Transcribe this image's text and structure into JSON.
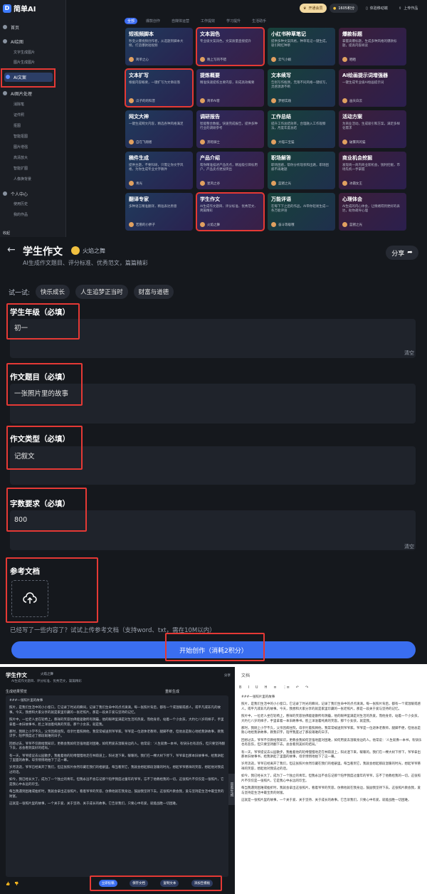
{
  "app": {
    "name": "简单AI"
  },
  "sidebar": {
    "home": "首页",
    "section_ai_image": "AI绘图",
    "ai_image_items": [
      "文字生成图片",
      "图片生成图片"
    ],
    "ai_writing": "AI文案",
    "section_ai_image_process": "AI图片处理",
    "process_items": [
      "消除笔",
      "证件照",
      "抠图",
      "智能抠图",
      "图片增强",
      "高清放大",
      "智能扩图",
      "人像换背景"
    ],
    "section_personal": "个人中心",
    "personal_items": [
      "使用历史",
      "我的作品"
    ],
    "collapse": "收起"
  },
  "topbar": {
    "member": "开通会员",
    "points": "1605积分",
    "mobile": "体验移动端",
    "upload": "上传作品"
  },
  "category_tabs": [
    {
      "label": "全部",
      "active": true
    },
    {
      "label": "爆款创作"
    },
    {
      "label": "自媒体运营"
    },
    {
      "label": "工作提效"
    },
    {
      "label": "学习提升"
    },
    {
      "label": "生活助手"
    }
  ],
  "cards": [
    {
      "title": "短视频脚本",
      "desc": "秒变火爆视频创作者，从选题到脚本大纲，打造爆款短视频",
      "author": "简单之心"
    },
    {
      "title": "文本润色",
      "desc": "专业级文案润色，文案质量直接提升",
      "author": "晚上写的不错",
      "highlight": true
    },
    {
      "title": "小红书种草笔记",
      "desc": "提供多种文案风格，种草笔记一键生成，吸引网红种草",
      "author": "云气小娟"
    },
    {
      "title": "爆款标题",
      "desc": "掌握高爆标题，生成多种风格的爆款标题，提高内容阅读",
      "author": "晒晒"
    },
    {
      "title": "文本扩写",
      "desc": "根据内容概要，一键扩写为文章段落",
      "author": "瓜子的的科普",
      "highlight": true
    },
    {
      "title": "提炼概要",
      "desc": "精准快速提炼主要内容，形成高效概要",
      "author": "简单AI客"
    },
    {
      "title": "文本续写",
      "desc": "告别写作瓶颈，无限不同风格一键续写，灵感源源不断",
      "author": "梦想实践"
    },
    {
      "title": "AI绘画提示词增强器",
      "desc": "一键生成专业级AI绘画提示词",
      "author": "画天白云"
    },
    {
      "title": "网文大神",
      "desc": "一键生成网文内容，精选各种风格满足",
      "author": "自在飞翔者"
    },
    {
      "title": "调研报告",
      "desc": "智能整合数据，快速完成报告，提供多种行业的调研参考",
      "author": "黑暗骑士"
    },
    {
      "title": "工作总结",
      "desc": "提升工作总结效率，合理融入工作观察法，月度年度总结",
      "author": "大喵三宝猫"
    },
    {
      "title": "活动方案",
      "desc": "为商业活动，生成吸引和方案，满足多样化需求",
      "author": "破雾风的猫"
    },
    {
      "title": "稿件生成",
      "desc": "提供主题，不要科研，只需让你文字风格，为你生成专业文字稿件",
      "author": "青光"
    },
    {
      "title": "产品介绍",
      "desc": "帮你精准描述产品优点，精准吸引目标用户，产品卖点更加突出",
      "author": "星风之谷"
    },
    {
      "title": "职场解答",
      "desc": "职场困惑，帮你分析现状和出路，职场困惑不再难题",
      "author": "蓝猪之光"
    },
    {
      "title": "商业机会挖掘",
      "desc": "发现商一商内商业新机会，锐利挖掘，市场先机一手掌握",
      "author": "冰霜女王"
    },
    {
      "title": "翻译专家",
      "desc": "多种语言精准翻译，精准表达原意",
      "author": "若愿的小胖子"
    },
    {
      "title": "学生作文",
      "desc": "AI生成作文题目、评分标准、优秀范文、简篇精彩",
      "author": "火焰之舞",
      "highlight": true
    },
    {
      "title": "万能评语",
      "desc": "在每下下之后的作品，AI带你轻易生成一条万能评语",
      "author": "奋斗等级哦"
    },
    {
      "title": "心理体会",
      "desc": "AI生成的内心体会，让情绪得到更好的表达，助你疏导心理",
      "author": "蓝猪之光"
    }
  ],
  "form": {
    "title": "学生作文",
    "author": "火焰之舞",
    "subtitle": "AI生成作文题目、评分标准、优秀范文，篇篇精彩",
    "share": "分享",
    "try_label": "试一试:",
    "try_chips": [
      "快乐成长",
      "人生追梦正当时",
      "财富与道德"
    ],
    "grade_label": "学生年级（必填）",
    "grade_value": "初一",
    "topic_label": "作文题目（必填）",
    "topic_value": "一张照片里的故事",
    "type_label": "作文类型（必填）",
    "type_value": "记叙文",
    "words_label": "字数要求（必填）",
    "words_value": "800",
    "clear": "清空",
    "ref_label": "参考文档",
    "ref_hint": "已经写了一些内容了？试试上传参考文档（支持word、txt，需在10M以内）",
    "start": "开始创作（消耗2积分）"
  },
  "result": {
    "title": "学生作文",
    "author": "火焰之舞",
    "subtitle": "AI生成作文题目、评分标准、优秀范文，篇篇精彩",
    "share": "分享",
    "header": "生成结果预览",
    "header_right": "重新生成",
    "essay_title": "###一张照片里的故事",
    "paragraphs": [
      "照片，是我们生活中的小小窗口，它记录了时光的瞬间，记录了我们生命中的点点滴滴。每一张照片背后，都有一个或温暖或感人，或平凡或非凡的故事。今天，我想和大家分享的就是家里珍藏的一张老照片，那是一段关于爱与坚持的记忆。",
      "照片中，一位老人坐在轮椅上，慈祥的笑容仿佛能驱散所有阴霾，他的眼神里满是对生活的热爱。而他身旁，站着一个小女孩，大约七八岁的样子，手里拿着一本旧故事书，脸上洋溢着纯真的笑容。那个小女孩，就是我。",
      "那时，我刚上小学不久，父亲因病住院，母亲忙着照顾他，我常常被送到爷爷家。爷爷是一位退休老教师，腿脚不便，但他总是耐心地给我讲故事，教我识字，陪伴我度过了那段艰难的日子。",
      "回想过去，爷爷不仅教给我知识，更教会我如何坚强地面对困难，如何用爱去温暖身边的人。他常说：‘人生就像一本书，有快乐也有悲伤，但只要坚持翻下去，总会看到美好的结局。’",
      "有一天，爷爷提议去公园散步，我推着他的轮椅慢慢地走在林荫道上，阳光洒下来，暖暖的。我们在一棵大树下停下，爷爷拿出那本旧故事书，给我讲起了里面的故事，母亲悄悄地拍下了这一幕。",
      "岁月流逝，爷爷已经离开了我们，但这张照片依然珍藏在我们的相册里。每当看到它，我就会想起那段温暖的时光，想起爷爷慈祥的笑容，想起他对我说过的话。",
      "如今，我已经长大了，成为了一个独立的青年。但我永远不会忘记那个陪伴我度过童年的爷爷，忘不了他教给我的一切。这张照片不仅仅是一张照片，它是我心中永远的珍宝。",
      "每当我遇到困难或挫折时，我就会拿出这张照片，看着爷爷的笑容，仿佛他就在我身边，鼓励我坚持下去。这张照片教会我，爱与坚持是生活中最宝贵的财富。",
      "这就是一张照片里的故事，一个关于爱、关于坚持、关于成长的故事。它告诉我们，只要心中有爱，就能战胜一切困难。"
    ],
    "buttons": [
      "立即投稿",
      "保存文档",
      "复制文本",
      "添加至模板"
    ],
    "side_tab": "查看生成",
    "doc_title": "文档",
    "doc_tools": [
      "B",
      "I",
      "U",
      "H",
      "≡",
      "⋮≡",
      "↶",
      "↷"
    ]
  }
}
